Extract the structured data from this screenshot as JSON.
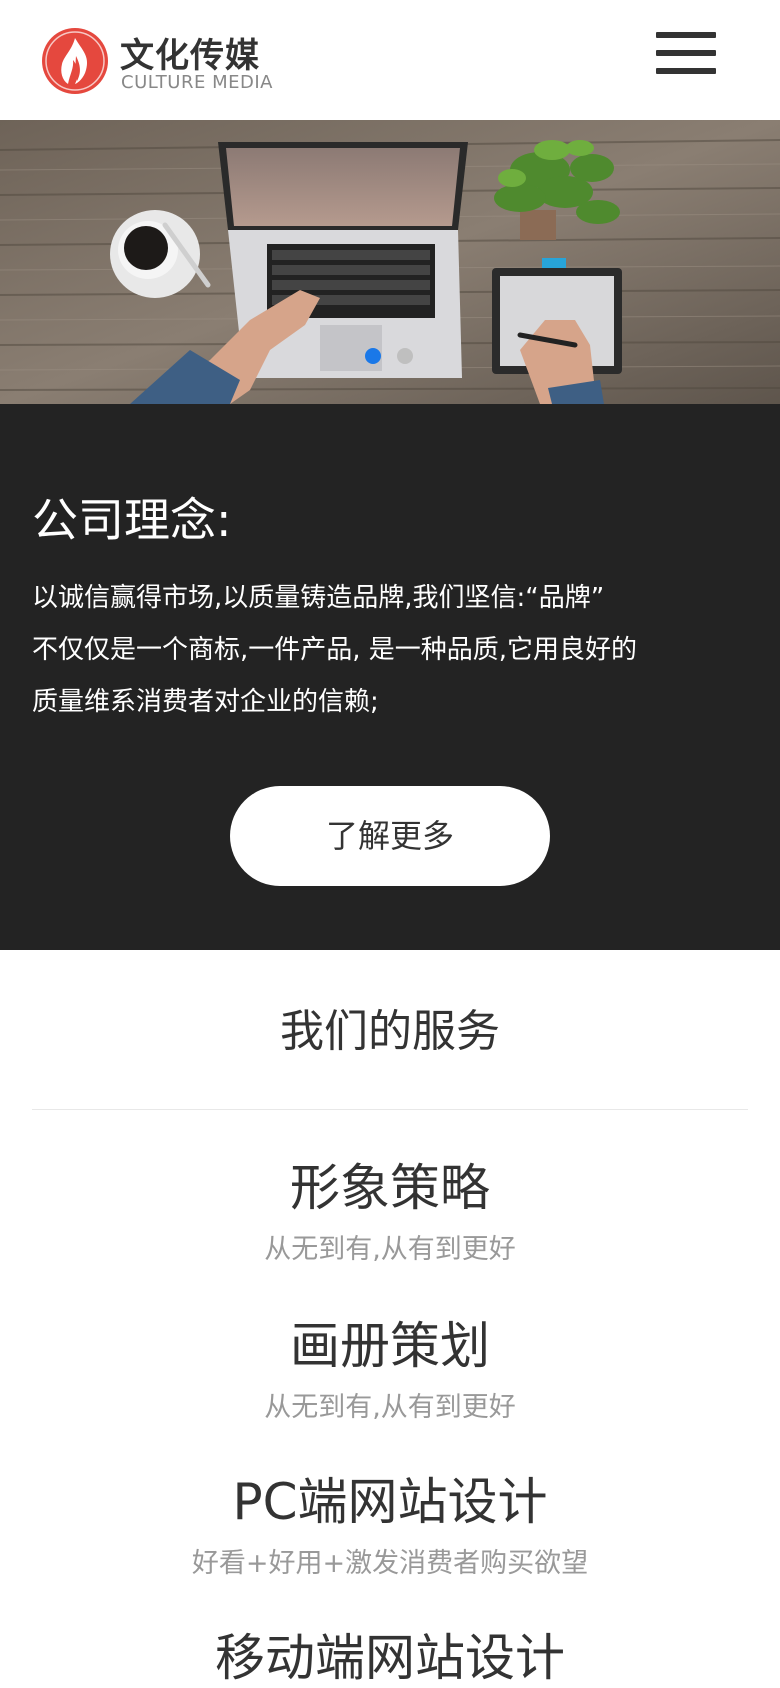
{
  "header": {
    "brand_cn": "文化传媒",
    "brand_en": "CULTURE MEDIA",
    "logo_icon": "flame-logo-icon",
    "menu_icon": "hamburger-menu-icon",
    "accent": "#e5483e"
  },
  "banner": {
    "image": "laptop-desk-photo",
    "slide_count": 2,
    "active_slide": 1,
    "dot_active_color": "#1a78e8"
  },
  "philosophy": {
    "title": "公司理念:",
    "lines": [
      "以诚信赢得市场,以质量铸造品牌,我们坚信:“品牌”",
      "不仅仅是一个商标,一件产品, 是一种品质,它用良好的",
      "质量维系消费者对企业的信赖;"
    ],
    "button": "了解更多",
    "background": "#232323"
  },
  "services": {
    "title": "我们的服务",
    "items": [
      {
        "name": "形象策略",
        "desc": "从无到有,从有到更好"
      },
      {
        "name": "画册策划",
        "desc": "从无到有,从有到更好"
      },
      {
        "name": "PC端网站设计",
        "desc": "好看+好用+激发消费者购买欲望"
      },
      {
        "name": "移动端网站设计",
        "desc": ""
      }
    ]
  }
}
